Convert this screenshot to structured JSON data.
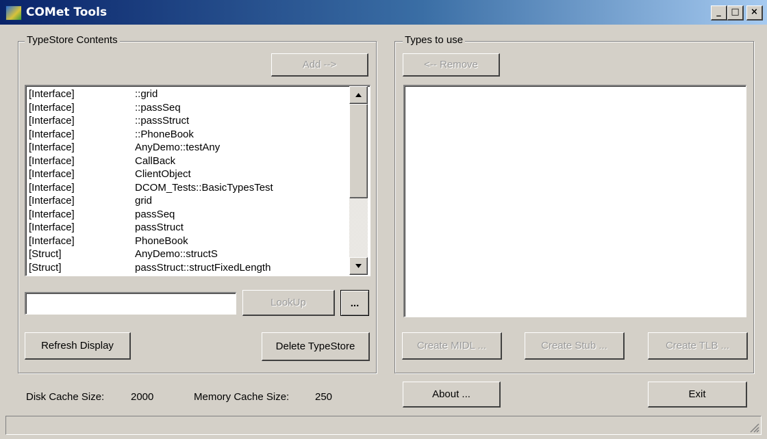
{
  "window": {
    "title": "COMet Tools",
    "minimize": "_",
    "maximize": "□",
    "close": "×"
  },
  "typestore": {
    "legend": "TypeStore Contents",
    "add_button": "Add -->",
    "items": [
      {
        "kind": "[Interface]",
        "name": "::grid"
      },
      {
        "kind": "[Interface]",
        "name": "::passSeq"
      },
      {
        "kind": "[Interface]",
        "name": "::passStruct"
      },
      {
        "kind": "[Interface]",
        "name": "::PhoneBook"
      },
      {
        "kind": "[Interface]",
        "name": "AnyDemo::testAny"
      },
      {
        "kind": "[Interface]",
        "name": "CallBack"
      },
      {
        "kind": "[Interface]",
        "name": "ClientObject"
      },
      {
        "kind": "[Interface]",
        "name": "DCOM_Tests::BasicTypesTest"
      },
      {
        "kind": "[Interface]",
        "name": "grid"
      },
      {
        "kind": "[Interface]",
        "name": "passSeq"
      },
      {
        "kind": "[Interface]",
        "name": "passStruct"
      },
      {
        "kind": "[Interface]",
        "name": "PhoneBook"
      },
      {
        "kind": "[Struct]",
        "name": "AnyDemo::structS"
      },
      {
        "kind": "[Struct]",
        "name": "passStruct::structFixedLength"
      }
    ],
    "lookup_value": "",
    "lookup_button": "LookUp",
    "browse_button": "...",
    "refresh_button": "Refresh Display",
    "delete_button": "Delete TypeStore"
  },
  "types_to_use": {
    "legend": "Types to use",
    "remove_button": "<-- Remove",
    "create_midl_button": "Create MIDL ...",
    "create_stub_button": "Create Stub ...",
    "create_tlb_button": "Create TLB ..."
  },
  "footer": {
    "disk_cache_label": "Disk Cache Size:",
    "disk_cache_value": "2000",
    "memory_cache_label": "Memory Cache Size:",
    "memory_cache_value": "250",
    "about_button": "About ...",
    "exit_button": "Exit"
  },
  "colors": {
    "title_start": "#0a246a",
    "title_end": "#a6caf0",
    "face": "#d4d0c8"
  }
}
